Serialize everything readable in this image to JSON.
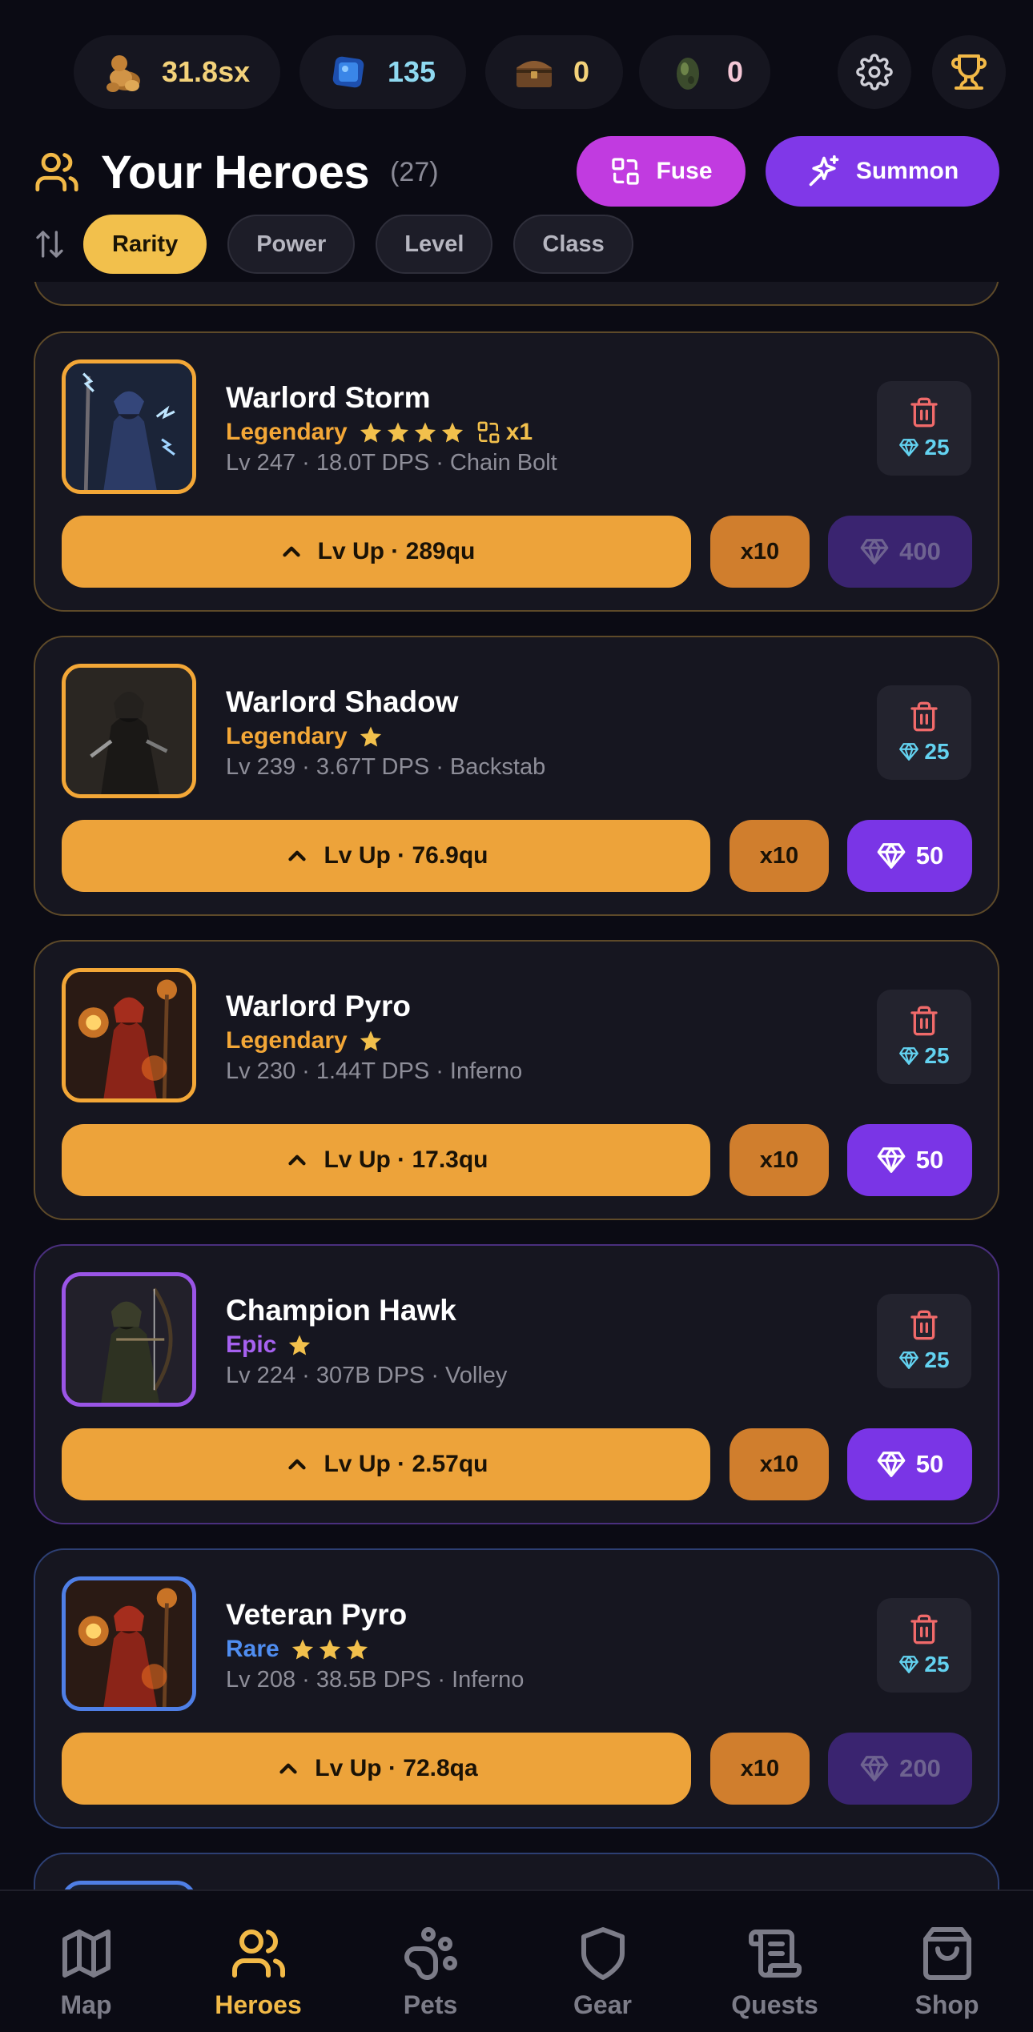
{
  "currencies": [
    {
      "icon": "gold-coins-icon",
      "value": "31.8sx",
      "color": "#f3d27a"
    },
    {
      "icon": "blue-gem-icon",
      "value": "135",
      "color": "#8fd9f0"
    },
    {
      "icon": "treasure-chest-icon",
      "value": "0",
      "color": "#f3d27a"
    },
    {
      "icon": "egg-icon",
      "value": "0",
      "color": "#f5c7d6"
    }
  ],
  "header": {
    "title": "Your Heroes",
    "count": "(27)",
    "fuse_label": "Fuse",
    "summon_label": "Summon"
  },
  "filters": [
    {
      "label": "Rarity",
      "active": true
    },
    {
      "label": "Power",
      "active": false
    },
    {
      "label": "Level",
      "active": false
    },
    {
      "label": "Class",
      "active": false
    }
  ],
  "heroes": [
    {
      "name": "Warlord Storm",
      "rarity": "Legendary",
      "stars": 4,
      "fuse_count": "x1",
      "stats": "Lv 247 · 18.0T DPS · Chain Bolt",
      "delete_cost": "25",
      "levelup": "Lv Up · 289qu",
      "x10": "x10",
      "gem_cost": "400",
      "gem_affordable": false
    },
    {
      "name": "Warlord Shadow",
      "rarity": "Legendary",
      "stars": 1,
      "fuse_count": "",
      "stats": "Lv 239 · 3.67T DPS · Backstab",
      "delete_cost": "25",
      "levelup": "Lv Up · 76.9qu",
      "x10": "x10",
      "gem_cost": "50",
      "gem_affordable": true
    },
    {
      "name": "Warlord Pyro",
      "rarity": "Legendary",
      "stars": 1,
      "fuse_count": "",
      "stats": "Lv 230 · 1.44T DPS · Inferno",
      "delete_cost": "25",
      "levelup": "Lv Up · 17.3qu",
      "x10": "x10",
      "gem_cost": "50",
      "gem_affordable": true
    },
    {
      "name": "Champion Hawk",
      "rarity": "Epic",
      "stars": 1,
      "fuse_count": "",
      "stats": "Lv 224 · 307B DPS · Volley",
      "delete_cost": "25",
      "levelup": "Lv Up · 2.57qu",
      "x10": "x10",
      "gem_cost": "50",
      "gem_affordable": true
    },
    {
      "name": "Veteran Pyro",
      "rarity": "Rare",
      "stars": 3,
      "fuse_count": "",
      "stats": "Lv 208 · 38.5B DPS · Inferno",
      "delete_cost": "25",
      "levelup": "Lv Up · 72.8qa",
      "x10": "x10",
      "gem_cost": "200",
      "gem_affordable": false
    }
  ],
  "nav": [
    {
      "icon": "map-icon",
      "label": "Map",
      "active": false
    },
    {
      "icon": "heroes-icon",
      "label": "Heroes",
      "active": true
    },
    {
      "icon": "paw-icon",
      "label": "Pets",
      "active": false
    },
    {
      "icon": "shield-icon",
      "label": "Gear",
      "active": false
    },
    {
      "icon": "scroll-icon",
      "label": "Quests",
      "active": false
    },
    {
      "icon": "shopping-bag-icon",
      "label": "Shop",
      "active": false
    }
  ],
  "colors": {
    "background": "#0b0b14",
    "legendary": "#f3a737",
    "epic": "#a661f0",
    "rare": "#4f8df0",
    "accent_purple": "#7a35e6",
    "accent_gold": "#f2b947"
  }
}
